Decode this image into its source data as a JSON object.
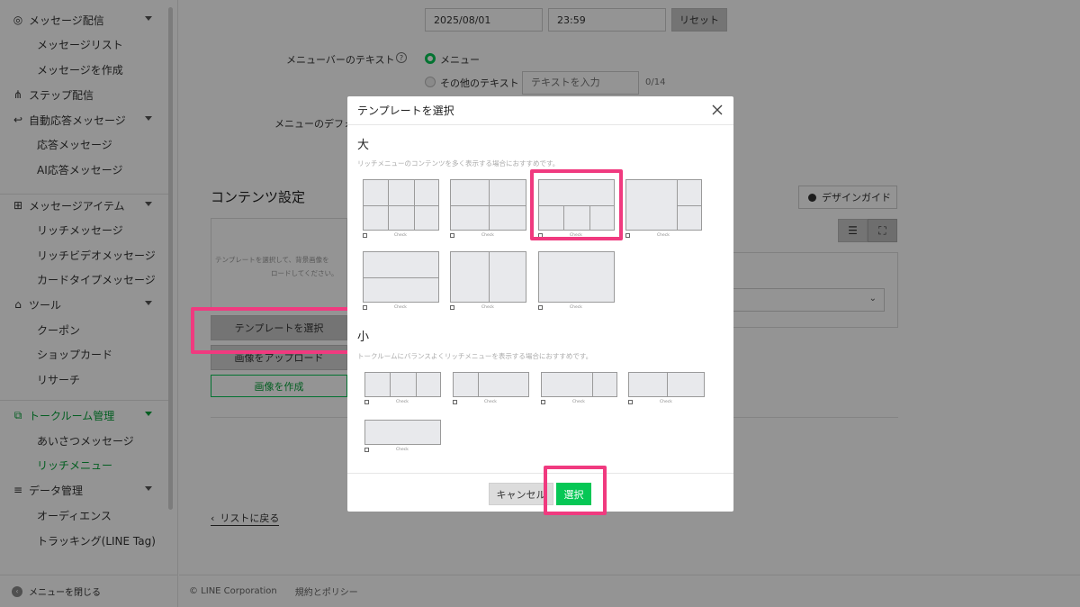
{
  "sidebar": {
    "items": [
      {
        "label": "メッセージ配信",
        "level": "parent",
        "icon": "broadcast-icon",
        "caret": true
      },
      {
        "label": "メッセージリスト",
        "level": "child"
      },
      {
        "label": "メッセージを作成",
        "level": "child"
      },
      {
        "label": "ステップ配信",
        "level": "parent",
        "icon": "step-tree-icon",
        "caret": false
      },
      {
        "label": "自動応答メッセージ",
        "level": "parent",
        "icon": "reply-icon",
        "caret": true
      },
      {
        "label": "応答メッセージ",
        "level": "child"
      },
      {
        "label": "AI応答メッセージ",
        "level": "child"
      },
      {
        "label": "メッセージアイテム",
        "level": "parent",
        "icon": "plus-box-icon",
        "caret": true
      },
      {
        "label": "リッチメッセージ",
        "level": "child"
      },
      {
        "label": "リッチビデオメッセージ",
        "level": "child"
      },
      {
        "label": "カードタイプメッセージ",
        "level": "child"
      },
      {
        "label": "ツール",
        "level": "parent",
        "icon": "shop-icon",
        "caret": true
      },
      {
        "label": "クーポン",
        "level": "child"
      },
      {
        "label": "ショップカード",
        "level": "child"
      },
      {
        "label": "リサーチ",
        "level": "child"
      },
      {
        "label": "トークルーム管理",
        "level": "parent",
        "icon": "chat-room-icon",
        "caret": true,
        "active": true
      },
      {
        "label": "あいさつメッセージ",
        "level": "child"
      },
      {
        "label": "リッチメニュー",
        "level": "child",
        "active": true
      },
      {
        "label": "データ管理",
        "level": "parent",
        "icon": "database-icon",
        "caret": true
      },
      {
        "label": "オーディエンス",
        "level": "child"
      },
      {
        "label": "トラッキング(LINE Tag)",
        "level": "child"
      }
    ],
    "close_menu": "メニューを閉じる"
  },
  "main": {
    "date_value": "2025/08/01",
    "time_value": "23:59",
    "reset_label": "リセット",
    "menubar_text_label": "メニューバーのテキスト",
    "help_glyph": "?",
    "radio_menu": "メニュー",
    "radio_other": "その他のテキスト",
    "text_placeholder": "テキストを入力",
    "char_count": "0/14",
    "menu_default_label": "メニューのデフォ",
    "content_settings_title": "コンテンツ設定",
    "design_guide": "デザインガイド",
    "upload_hint_1": "テンプレートを選択して、背景画像を",
    "upload_hint_2": "ロードしてください。",
    "select_template_btn": "テンプレートを選択",
    "upload_image_btn": "画像をアップロード",
    "create_image_btn": "画像を作成",
    "back_to_list": "リストに戻る"
  },
  "footer": {
    "copyright": "© LINE Corporation",
    "policy": "規約とポリシー"
  },
  "modal": {
    "title": "テンプレートを選択",
    "large": {
      "title": "大",
      "description": "リッチメニューのコンテンツを多く表示する場合におすすめです。"
    },
    "small": {
      "title": "小",
      "description": "トークルームにバランスよくリッチメニューを表示する場合におすすめです。"
    },
    "template_caption": "Check",
    "cancel_label": "キャンセル",
    "select_label": "選択",
    "selected_template": "large-3"
  },
  "colors": {
    "line_green": "#06c755",
    "active_green": "#06a33a",
    "highlight_pink": "#f03a7f"
  }
}
